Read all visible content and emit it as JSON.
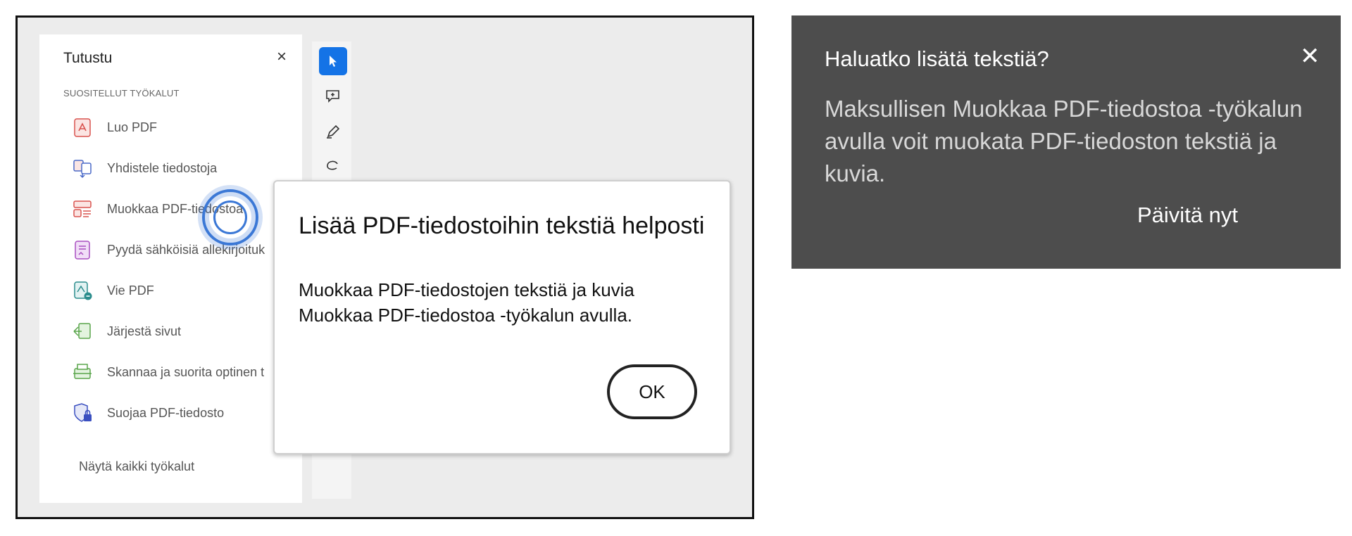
{
  "panel": {
    "title": "Tutustu",
    "close": "×",
    "section": "SUOSITELLUT TYÖKALUT",
    "tools": [
      {
        "label": "Luo PDF",
        "icon": "create-pdf-icon"
      },
      {
        "label": "Yhdistele tiedostoja",
        "icon": "combine-files-icon"
      },
      {
        "label": "Muokkaa PDF-tiedostoa",
        "icon": "edit-pdf-icon"
      },
      {
        "label": "Pyydä sähköisiä allekirjoituk",
        "icon": "request-esign-icon"
      },
      {
        "label": "Vie PDF",
        "icon": "export-pdf-icon"
      },
      {
        "label": "Järjestä sivut",
        "icon": "organize-pages-icon"
      },
      {
        "label": "Skannaa ja suorita optinen t",
        "icon": "scan-ocr-icon"
      },
      {
        "label": "Suojaa PDF-tiedosto",
        "icon": "protect-pdf-icon"
      }
    ],
    "show_all": "Näytä kaikki työkalut"
  },
  "toolbar": {
    "buttons": [
      "select-tool-icon",
      "add-comment-icon",
      "highlight-pen-icon",
      "draw-freeform-icon"
    ]
  },
  "dialog": {
    "title": "Lisää PDF-tiedostoihin tekstiä helposti",
    "body_line1": "Muokkaa PDF-tiedostojen tekstiä ja kuvia",
    "body_line2": "Muokkaa PDF-tiedostoa -työkalun avulla.",
    "ok": "OK"
  },
  "tooltip": {
    "title": "Haluatko lisätä tekstiä?",
    "close": "✕",
    "body": "Maksullisen Muokkaa PDF-tiedostoa -työkalun avulla voit muokata PDF-tiedoston tekstiä ja kuvia.",
    "action": "Päivitä nyt"
  },
  "colors": {
    "accent": "#1473e6",
    "tooltip_bg": "#4d4d4d",
    "pdf_red": "#d9534f",
    "esign_purple": "#a94fc0",
    "export_teal": "#2a8c8c",
    "organize_green": "#5aa54b",
    "protect_blue": "#3a4fc0"
  }
}
